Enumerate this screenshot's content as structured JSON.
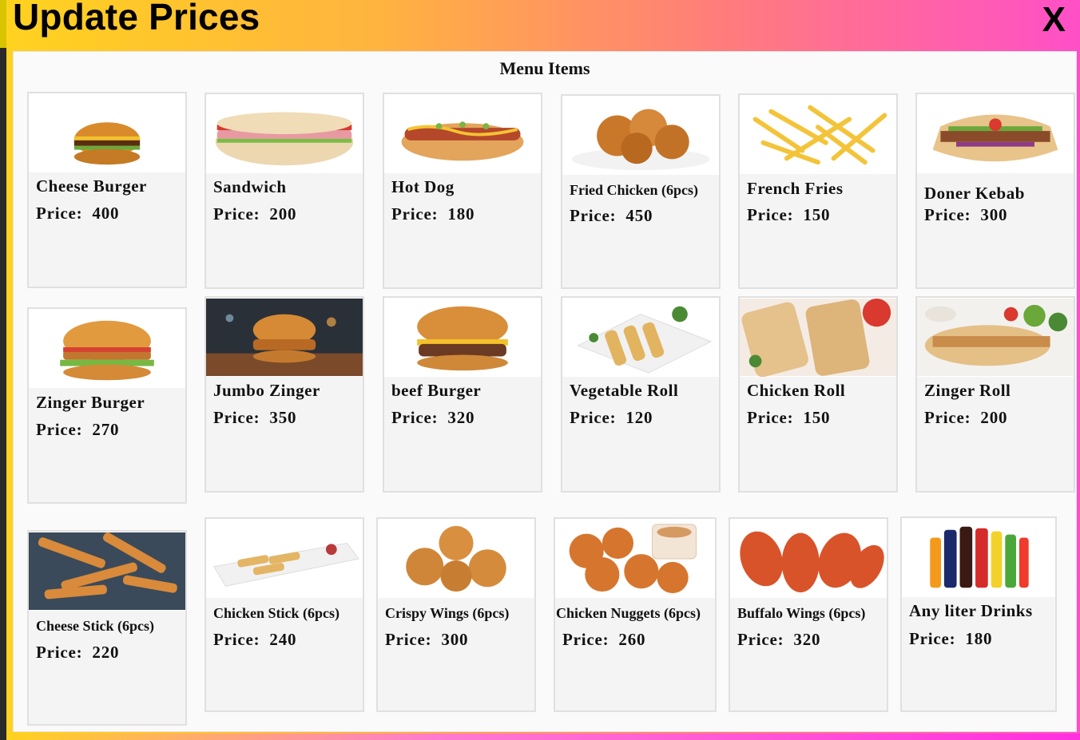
{
  "window": {
    "title": "Update Prices",
    "close_label": "X"
  },
  "panel": {
    "title": "Menu Items"
  },
  "price_label": "Price:",
  "items": [
    {
      "name": "Cheese Burger",
      "price": "400",
      "icon": "cheese-burger"
    },
    {
      "name": "Sandwich",
      "price": "200",
      "icon": "sandwich"
    },
    {
      "name": "Hot Dog",
      "price": "180",
      "icon": "hot-dog"
    },
    {
      "name": "Fried Chicken (6pcs)",
      "price": "450",
      "icon": "fried-chicken"
    },
    {
      "name": "French Fries",
      "price": "150",
      "icon": "french-fries"
    },
    {
      "name": "Doner Kebab",
      "price": "300",
      "icon": "doner-kebab"
    },
    {
      "name": "Zinger Burger",
      "price": "270",
      "icon": "zinger-burger"
    },
    {
      "name": "Jumbo Zinger",
      "price": "350",
      "icon": "jumbo-zinger"
    },
    {
      "name": "beef Burger",
      "price": "320",
      "icon": "beef-burger"
    },
    {
      "name": "Vegetable Roll",
      "price": "120",
      "icon": "vegetable-roll"
    },
    {
      "name": "Chicken Roll",
      "price": "150",
      "icon": "chicken-roll"
    },
    {
      "name": "Zinger Roll",
      "price": "200",
      "icon": "zinger-roll"
    },
    {
      "name": "Cheese Stick (6pcs)",
      "price": "220",
      "icon": "cheese-stick"
    },
    {
      "name": "Chicken Stick (6pcs)",
      "price": "240",
      "icon": "chicken-stick"
    },
    {
      "name": "Crispy Wings (6pcs)",
      "price": "300",
      "icon": "crispy-wings"
    },
    {
      "name": "Chicken Nuggets (6pcs)",
      "price": "260",
      "icon": "chicken-nuggets"
    },
    {
      "name": "Buffalo Wings (6pcs)",
      "price": "320",
      "icon": "buffalo-wings"
    },
    {
      "name": "Any liter Drinks",
      "price": "180",
      "icon": "drinks"
    }
  ]
}
